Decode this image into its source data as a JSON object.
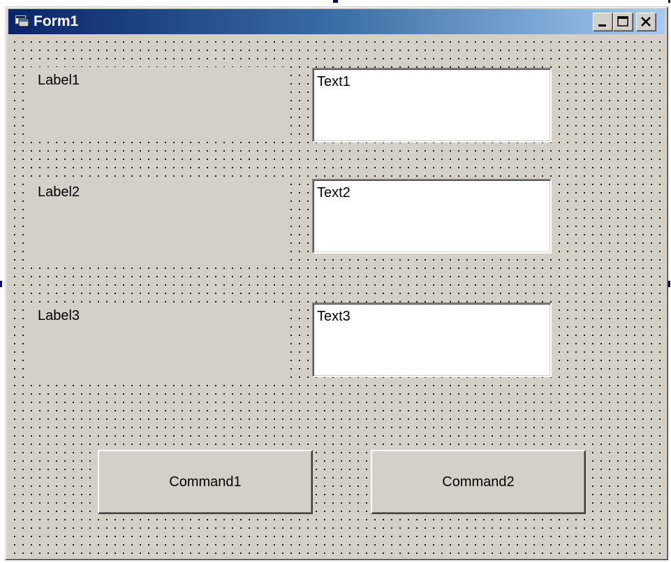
{
  "window": {
    "title": "Form1",
    "title_bar_colors": [
      "#0a246a",
      "#a6caf0"
    ],
    "face_color": "#d4d0c8",
    "icon": "form-icon",
    "buttons": [
      "minimize-icon",
      "maximize-icon",
      "close-icon"
    ]
  },
  "labels": [
    {
      "text": "Label1"
    },
    {
      "text": "Label2"
    },
    {
      "text": "Label3"
    }
  ],
  "textboxes": [
    {
      "value": "Text1"
    },
    {
      "value": "Text2"
    },
    {
      "value": "Text3"
    }
  ],
  "commands": [
    {
      "label": "Command1"
    },
    {
      "label": "Command2"
    }
  ]
}
